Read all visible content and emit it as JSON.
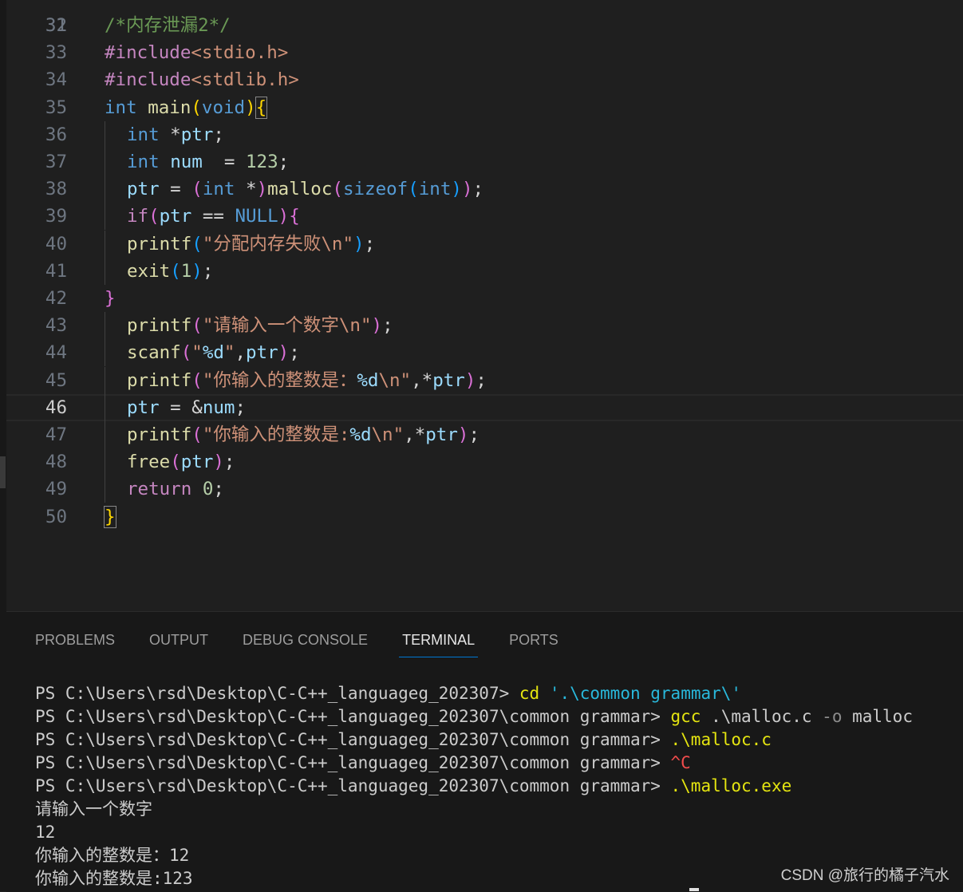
{
  "colors": {
    "background": "#1f1f1f",
    "panel": "#181818",
    "accent": "#0078d4"
  },
  "editor": {
    "partial_top_line": "31",
    "current_line": "46",
    "lines": [
      {
        "n": "32",
        "indent": false,
        "tokens": [
          [
            "/*内存泄漏2*/",
            "com"
          ]
        ]
      },
      {
        "n": "33",
        "indent": false,
        "tokens": [
          [
            "#include",
            "inc"
          ],
          [
            "<stdio.h>",
            "str"
          ]
        ]
      },
      {
        "n": "34",
        "indent": false,
        "tokens": [
          [
            "#include",
            "inc"
          ],
          [
            "<stdlib.h>",
            "str"
          ]
        ]
      },
      {
        "n": "35",
        "indent": false,
        "tokens": [
          [
            "int",
            "kw"
          ],
          [
            " ",
            "pl"
          ],
          [
            "main",
            "fn"
          ],
          [
            "(",
            "b1"
          ],
          [
            "void",
            "kw"
          ],
          [
            ")",
            "b1"
          ],
          [
            "{",
            "match"
          ]
        ]
      },
      {
        "n": "36",
        "indent": true,
        "tokens": [
          [
            "int",
            "kw"
          ],
          [
            " *",
            "pl"
          ],
          [
            "ptr",
            "var"
          ],
          [
            ";",
            "pl"
          ]
        ]
      },
      {
        "n": "37",
        "indent": true,
        "tokens": [
          [
            "int",
            "kw"
          ],
          [
            " ",
            "pl"
          ],
          [
            "num",
            "var"
          ],
          [
            "  = ",
            "pl"
          ],
          [
            "123",
            "num"
          ],
          [
            ";",
            "pl"
          ]
        ]
      },
      {
        "n": "38",
        "indent": true,
        "tokens": [
          [
            "ptr",
            "var"
          ],
          [
            " = ",
            "pl"
          ],
          [
            "(",
            "b2"
          ],
          [
            "int",
            "kw"
          ],
          [
            " *",
            "pl"
          ],
          [
            ")",
            "b2"
          ],
          [
            "malloc",
            "fn"
          ],
          [
            "(",
            "b2"
          ],
          [
            "sizeof",
            "kw"
          ],
          [
            "(",
            "b3"
          ],
          [
            "int",
            "kw"
          ],
          [
            ")",
            "b3"
          ],
          [
            ")",
            "b2"
          ],
          [
            ";",
            "pl"
          ]
        ]
      },
      {
        "n": "39",
        "indent": true,
        "tokens": [
          [
            "if",
            "inc"
          ],
          [
            "(",
            "b2"
          ],
          [
            "ptr",
            "var"
          ],
          [
            " == ",
            "pl"
          ],
          [
            "NULL",
            "kw"
          ],
          [
            ")",
            "b2"
          ],
          [
            "{",
            "b2"
          ]
        ]
      },
      {
        "n": "40",
        "indent": true,
        "tokens": [
          [
            "printf",
            "fn"
          ],
          [
            "(",
            "b3"
          ],
          [
            "\"分配内存失败\\n\"",
            "str"
          ],
          [
            ")",
            "b3"
          ],
          [
            ";",
            "pl"
          ]
        ]
      },
      {
        "n": "41",
        "indent": true,
        "tokens": [
          [
            "exit",
            "fn"
          ],
          [
            "(",
            "b3"
          ],
          [
            "1",
            "num"
          ],
          [
            ")",
            "b3"
          ],
          [
            ";",
            "pl"
          ]
        ]
      },
      {
        "n": "42",
        "indent": false,
        "tokens": [
          [
            "}",
            "b2"
          ]
        ]
      },
      {
        "n": "43",
        "indent": true,
        "tokens": [
          [
            "printf",
            "fn"
          ],
          [
            "(",
            "b2"
          ],
          [
            "\"请输入一个数字\\n\"",
            "str"
          ],
          [
            ")",
            "b2"
          ],
          [
            ";",
            "pl"
          ]
        ]
      },
      {
        "n": "44",
        "indent": true,
        "tokens": [
          [
            "scanf",
            "fn"
          ],
          [
            "(",
            "b2"
          ],
          [
            "\"",
            "str"
          ],
          [
            "%d",
            "var"
          ],
          [
            "\"",
            "str"
          ],
          [
            ",",
            "pl"
          ],
          [
            "ptr",
            "var"
          ],
          [
            ")",
            "b2"
          ],
          [
            ";",
            "pl"
          ]
        ]
      },
      {
        "n": "45",
        "indent": true,
        "tokens": [
          [
            "printf",
            "fn"
          ],
          [
            "(",
            "b2"
          ],
          [
            "\"你输入的整数是：",
            "str"
          ],
          [
            "%d",
            "var"
          ],
          [
            "\\n\"",
            "str"
          ],
          [
            ",*",
            "pl"
          ],
          [
            "ptr",
            "var"
          ],
          [
            ")",
            "b2"
          ],
          [
            ";",
            "pl"
          ]
        ]
      },
      {
        "n": "46",
        "indent": true,
        "tokens": [
          [
            "ptr",
            "var"
          ],
          [
            " = &",
            "pl"
          ],
          [
            "num",
            "var"
          ],
          [
            ";",
            "pl"
          ]
        ]
      },
      {
        "n": "47",
        "indent": true,
        "tokens": [
          [
            "printf",
            "fn"
          ],
          [
            "(",
            "b2"
          ],
          [
            "\"你输入的整数是:",
            "str"
          ],
          [
            "%d",
            "var"
          ],
          [
            "\\n\"",
            "str"
          ],
          [
            ",*",
            "pl"
          ],
          [
            "ptr",
            "var"
          ],
          [
            ")",
            "b2"
          ],
          [
            ";",
            "pl"
          ]
        ]
      },
      {
        "n": "48",
        "indent": true,
        "tokens": [
          [
            "free",
            "fn"
          ],
          [
            "(",
            "b2"
          ],
          [
            "ptr",
            "var"
          ],
          [
            ")",
            "b2"
          ],
          [
            ";",
            "pl"
          ]
        ]
      },
      {
        "n": "49",
        "indent": true,
        "tokens": [
          [
            "return",
            "inc"
          ],
          [
            " ",
            "pl"
          ],
          [
            "0",
            "num"
          ],
          [
            ";",
            "pl"
          ]
        ]
      },
      {
        "n": "50",
        "indent": false,
        "tokens": [
          [
            "}",
            "match"
          ]
        ]
      }
    ]
  },
  "panel": {
    "tabs": [
      {
        "label": "PROBLEMS"
      },
      {
        "label": "OUTPUT"
      },
      {
        "label": "DEBUG CONSOLE"
      },
      {
        "label": "TERMINAL",
        "active": true
      },
      {
        "label": "PORTS"
      }
    ],
    "terminal": [
      [
        [
          "PS C:\\Users\\rsd\\Desktop\\C-C++_languageg_202307> ",
          ""
        ],
        [
          "cd",
          "cmd"
        ],
        [
          " ",
          ""
        ],
        [
          "'.\\common grammar\\'",
          "str"
        ]
      ],
      [
        [
          "PS C:\\Users\\rsd\\Desktop\\C-C++_languageg_202307\\common grammar> ",
          ""
        ],
        [
          "gcc",
          "cmd"
        ],
        [
          " .\\malloc.c ",
          ""
        ],
        [
          "-o",
          "flag"
        ],
        [
          " malloc",
          ""
        ]
      ],
      [
        [
          "PS C:\\Users\\rsd\\Desktop\\C-C++_languageg_202307\\common grammar> ",
          ""
        ],
        [
          ".\\malloc.c",
          "cmd"
        ]
      ],
      [
        [
          "PS C:\\Users\\rsd\\Desktop\\C-C++_languageg_202307\\common grammar> ",
          ""
        ],
        [
          "^C",
          "red"
        ]
      ],
      [
        [
          "PS C:\\Users\\rsd\\Desktop\\C-C++_languageg_202307\\common grammar> ",
          ""
        ],
        [
          ".\\malloc.exe",
          "cmd"
        ]
      ],
      [
        [
          "请输入一个数字",
          ""
        ]
      ],
      [
        [
          "12",
          ""
        ]
      ],
      [
        [
          "你输入的整数是：12",
          ""
        ]
      ],
      [
        [
          "你输入的整数是:123",
          ""
        ]
      ]
    ]
  },
  "watermark": "CSDN @旅行的橘子汽水"
}
